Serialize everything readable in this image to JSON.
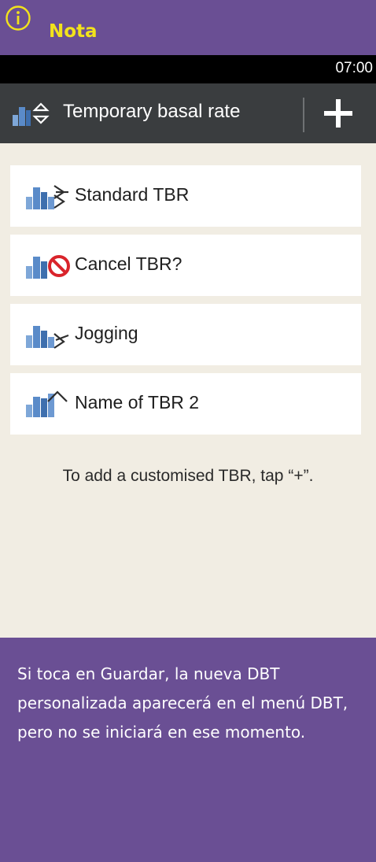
{
  "note": {
    "title": "Nota",
    "icon": "info-icon",
    "accent": "#f2e21c",
    "background": "#6a4f94",
    "body": "Si toca en Guardar, la nueva DBT personalizada aparecerá en el menú DBT, pero no se iniciará en ese momento."
  },
  "device": {
    "status_bar": {
      "time": "07:00"
    },
    "title_bar": {
      "icon": "temporary-basal-rate-icon",
      "title": "Temporary basal rate",
      "add_button_icon": "plus-icon"
    },
    "tbr_list": [
      {
        "label": "Standard TBR",
        "icon": "standard-tbr-icon"
      },
      {
        "label": "Cancel TBR?",
        "icon": "cancel-tbr-icon"
      },
      {
        "label": "Jogging",
        "icon": "decrease-tbr-icon"
      },
      {
        "label": "Name of TBR 2",
        "icon": "increase-tbr-icon"
      }
    ],
    "hint": "To add a customised TBR, tap “+”."
  }
}
